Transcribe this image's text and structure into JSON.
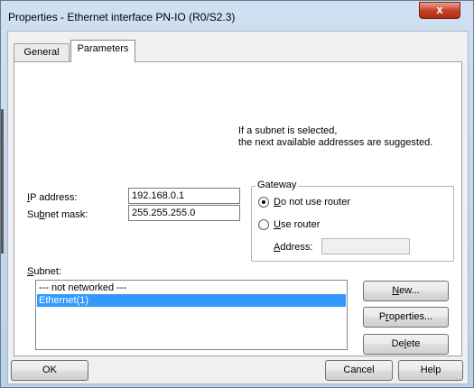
{
  "window": {
    "title": "Properties - Ethernet interface  PN-IO (R0/S2.3)",
    "close_glyph": "x"
  },
  "tabs": [
    {
      "label": "General"
    },
    {
      "label": "Parameters"
    }
  ],
  "hint": "If a subnet is selected,\nthe next available addresses are suggested.",
  "ip": {
    "label": "IP address:",
    "value": "192.168.0.1"
  },
  "subnet_mask": {
    "label": "Subnet mask:",
    "value": "255.255.255.0"
  },
  "gateway": {
    "title": "Gateway",
    "option_no_router": "Do not use router",
    "option_use_router": "Use router",
    "selected": "no_router",
    "address_label": "Address:",
    "address_value": ""
  },
  "subnet": {
    "label": "Subnet:",
    "items": [
      {
        "label": "--- not networked ---",
        "selected": false
      },
      {
        "label": "Ethernet(1)",
        "selected": true
      }
    ]
  },
  "side_buttons": {
    "new": "New...",
    "properties": "Properties...",
    "delete": "Delete"
  },
  "footer": {
    "ok": "OK",
    "cancel": "Cancel",
    "help": "Help"
  }
}
